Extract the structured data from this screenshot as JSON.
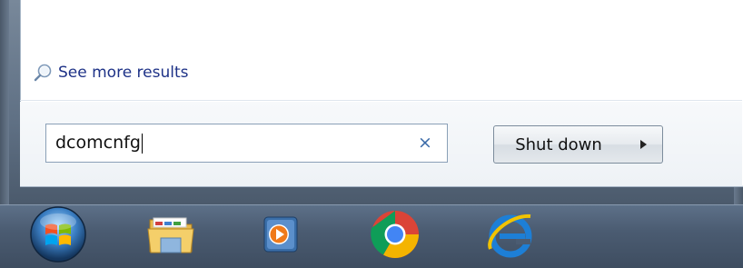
{
  "start_menu": {
    "see_more_label": "See more results",
    "search": {
      "value": "dcomcnfg",
      "clear_symbol": "×"
    },
    "shutdown": {
      "label": "Shut down",
      "arrow_icon": "triangle-right-icon"
    }
  },
  "taskbar": {
    "items": [
      {
        "name": "Start",
        "icon": "windows-orb-icon"
      },
      {
        "name": "Windows Explorer",
        "icon": "folder-icon"
      },
      {
        "name": "Windows Media Player",
        "icon": "media-player-icon"
      },
      {
        "name": "Google Chrome",
        "icon": "chrome-icon"
      },
      {
        "name": "Internet Explorer",
        "icon": "internet-explorer-icon"
      }
    ]
  },
  "colors": {
    "link": "#1e3287",
    "taskbar": "#4b5c72",
    "search_border": "#8aa0b7"
  }
}
